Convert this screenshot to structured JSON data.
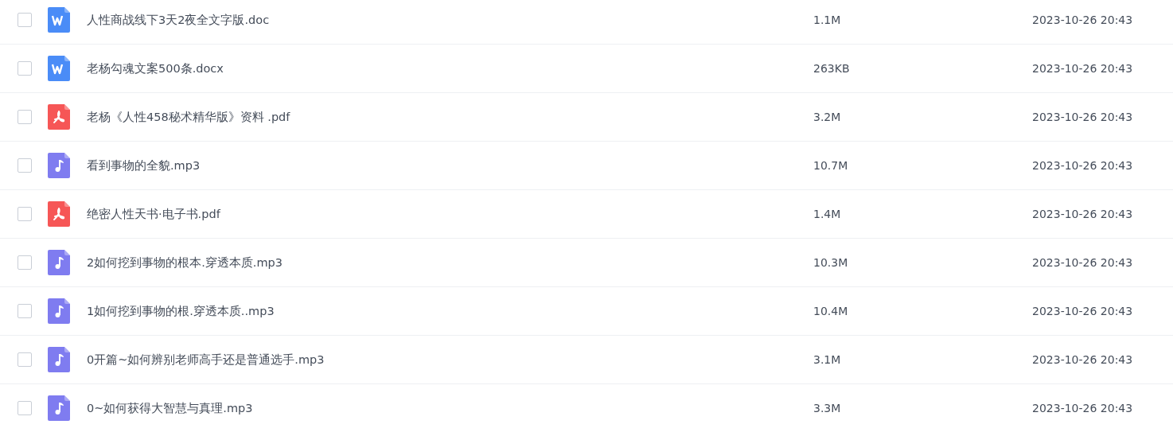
{
  "files": [
    {
      "name": "人性商战线下3天2夜全文字版.doc",
      "kind": "word",
      "size": "1.1M",
      "modified": "2023-10-26 20:43",
      "checked": false
    },
    {
      "name": "老杨勾魂文案500条.docx",
      "kind": "word",
      "size": "263KB",
      "modified": "2023-10-26 20:43",
      "checked": false
    },
    {
      "name": "老杨《人性458秘术精华版》资料 .pdf",
      "kind": "pdf",
      "size": "3.2M",
      "modified": "2023-10-26 20:43",
      "checked": false
    },
    {
      "name": "看到事物的全貌.mp3",
      "kind": "audio",
      "size": "10.7M",
      "modified": "2023-10-26 20:43",
      "checked": false
    },
    {
      "name": "绝密人性天书·电子书.pdf",
      "kind": "pdf",
      "size": "1.4M",
      "modified": "2023-10-26 20:43",
      "checked": false
    },
    {
      "name": "2如何挖到事物的根本.穿透本质.mp3",
      "kind": "audio",
      "size": "10.3M",
      "modified": "2023-10-26 20:43",
      "checked": false
    },
    {
      "name": "1如何挖到事物的根.穿透本质..mp3",
      "kind": "audio",
      "size": "10.4M",
      "modified": "2023-10-26 20:43",
      "checked": false
    },
    {
      "name": "0开篇~如何辨别老师高手还是普通选手.mp3",
      "kind": "audio",
      "size": "3.1M",
      "modified": "2023-10-26 20:43",
      "checked": false
    },
    {
      "name": "0~如何获得大智慧与真理.mp3",
      "kind": "audio",
      "size": "3.3M",
      "modified": "2023-10-26 20:43",
      "checked": false
    }
  ]
}
